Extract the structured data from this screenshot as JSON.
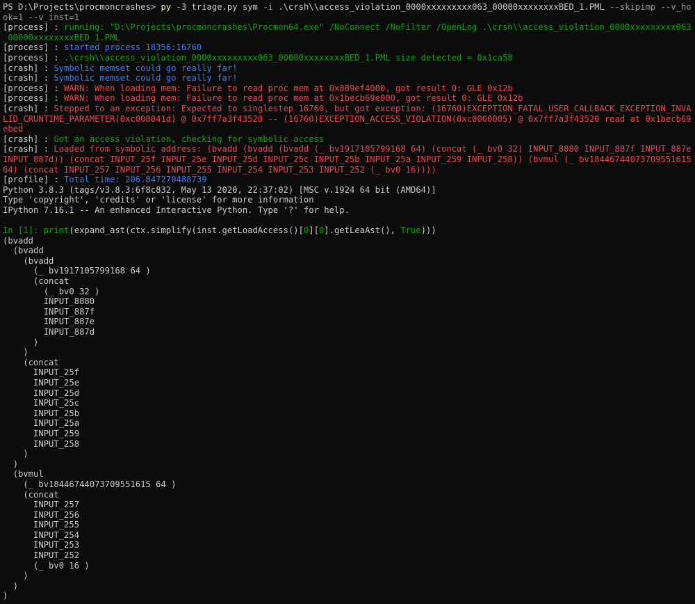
{
  "terminal": {
    "prompt": "PS D:\\Projects\\procmoncrashes> ",
    "command": {
      "exe": "py",
      "args_a": " -3 triage.py sym ",
      "flag_i": "-i",
      "path": " .\\crsh\\\\access_violation_0000xxxxxxxxx063_00000xxxxxxxxBED_1.PML ",
      "flags": "--skipimp --v_hook=1 --v_inst=1"
    },
    "log": [
      {
        "tag": "[process] :",
        "msg": " running: \"D:\\Projects\\procmoncrashes\\Procmon64.exe\" /NoConnect /NoFilter /OpenLog .\\crsh\\\\access_violation_0000xxxxxxxxx063_00000xxxxxxxxBED_1.PML",
        "color": "#13a10e"
      },
      {
        "tag": "[process] :",
        "msg": " started process 18356:16760",
        "color": "#3b78ff"
      },
      {
        "tag": "[process] :",
        "msg": " .\\crsh\\\\access_violation_0000xxxxxxxxx063_00000xxxxxxxxBED_1.PML size detected = 0x1ca58",
        "color": "#13a10e"
      },
      {
        "tag": "[crash] :",
        "msg": " Symbolic memset could go really far!",
        "color": "#3b78ff"
      },
      {
        "tag": "[crash] :",
        "msg": " Symbolic memset could go really far!",
        "color": "#3b78ff"
      },
      {
        "tag": "[process] :",
        "msg": " WARN: When loading mem: Failure to read proc mem at 0x889ef4000, got result 0: GLE 0x12b",
        "color": "#e74856"
      },
      {
        "tag": "[process] :",
        "msg": " WARN: When loading mem: Failure to read proc mem at 0x1becb69e000, got result 0: GLE 0x12b",
        "color": "#e74856"
      },
      {
        "tag": "[crash] :",
        "msg": " Stepped to an exception: Expected to singlestep 16760, but got exception: (16760)EXCEPTION_FATAL_USER_CALLBACK_EXCEPTION_INVALID_CRUNTIME_PARAMETER(0xc000041d) @ 0x7ff7a3f43520 -- (16760)EXCEPTION_ACCESS_VIOLATION(0xc0000005) @ 0x7ff7a3f43520 read at 0x1becb69ebed",
        "color": "#e74856"
      },
      {
        "tag": "[crash] :",
        "msg": " Got an access violation, checking for symbolic access",
        "color": "#13a10e"
      },
      {
        "tag": "[crash] :",
        "msg": " Loaded from symbolic address: (bvadd (bvadd (bvadd (_ bv1917105799168 64) (concat (_ bv0 32) INPUT_8880 INPUT_887f INPUT_887e INPUT_887d)) (concat INPUT_25f INPUT_25e INPUT_25d INPUT_25c INPUT_25b INPUT_25a INPUT_259 INPUT_258)) (bvmul (_ bv18446744073709551615 64) (concat INPUT_257 INPUT_256 INPUT_255 INPUT_254 INPUT_253 INPUT_252 (_ bv0 16))))",
        "color": "#e74856"
      },
      {
        "tag": "[profile] :",
        "msg": " Total time: 206.847270488739",
        "color": "#3b78ff"
      }
    ],
    "banner": [
      "Python 3.8.3 (tags/v3.8.3:6f8c832, May 13 2020, 22:37:02) [MSC v.1924 64 bit (AMD64)]",
      "Type 'copyright', 'credits' or 'license' for more information",
      "IPython 7.16.1 -- An enhanced Interactive Python. Type '?' for help."
    ],
    "in_prompt": "In [1]: ",
    "input": {
      "f1": "print",
      "p1": "(expand_ast(ctx.simplify(inst.getLoadAccess()[",
      "n1": "0",
      "p2": "][",
      "n2": "0",
      "p3": "].getLeaAst(), ",
      "kw": "True",
      "p4": ")))"
    },
    "output": [
      "(bvadd",
      "  (bvadd",
      "    (bvadd",
      "      (_ bv1917105799168 64 )",
      "      (concat",
      "        (_ bv0 32 )",
      "        INPUT_8880",
      "        INPUT_887f",
      "        INPUT_887e",
      "        INPUT_887d",
      "      )",
      "    )",
      "    (concat",
      "      INPUT_25f",
      "      INPUT_25e",
      "      INPUT_25d",
      "      INPUT_25c",
      "      INPUT_25b",
      "      INPUT_25a",
      "      INPUT_259",
      "      INPUT_258",
      "    )",
      "  )",
      "  (bvmul",
      "    (_ bv18446744073709551615 64 )",
      "    (concat",
      "      INPUT_257",
      "      INPUT_256",
      "      INPUT_255",
      "      INPUT_254",
      "      INPUT_253",
      "      INPUT_252",
      "      (_ bv0 16 )",
      "    )",
      "  )",
      ")"
    ]
  },
  "colors": {
    "background": "#0c0c0c",
    "text": "#cccccc",
    "green": "#13a10e",
    "blue": "#3b78ff",
    "red": "#e74856",
    "yellow": "#f9f1a5",
    "gray": "#9a9a9a"
  }
}
